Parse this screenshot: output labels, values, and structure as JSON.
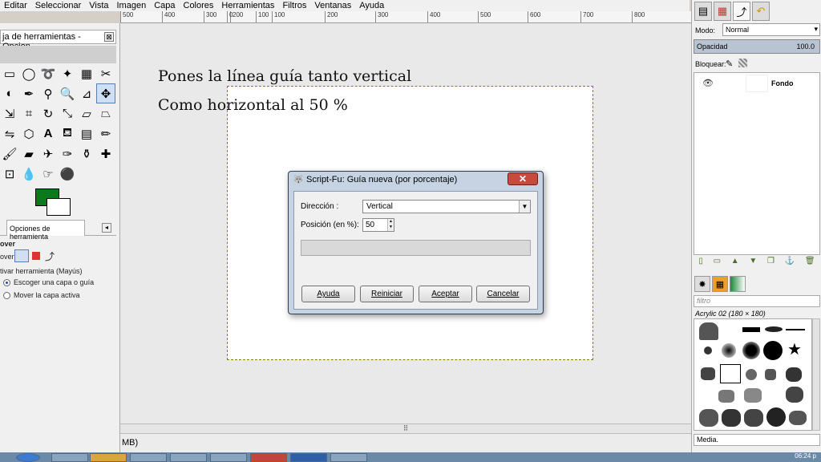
{
  "menubar": {
    "items": [
      "Editar",
      "Seleccionar",
      "Vista",
      "Imagen",
      "Capa",
      "Colores",
      "Herramientas",
      "Filtros",
      "Ventanas",
      "Ayuda"
    ]
  },
  "ruler": {
    "ticks": [
      "500",
      "400",
      "300",
      "200",
      "100",
      "0",
      "100",
      "200",
      "300",
      "400",
      "500",
      "600",
      "700",
      "800"
    ]
  },
  "canvas": {
    "line1": "Pones la línea guía tanto vertical",
    "line2": "Como horizontal al 50 %",
    "scroll_mark": "⠿",
    "status": "MB)"
  },
  "toolbox": {
    "title": "ja de herramientas - Opcion...",
    "close": "⊠",
    "options_tab": "Opciones de herramienta",
    "tab_menu": "◂",
    "tool_name": "over",
    "mode_label": "over:",
    "toggle_label": "tivar herramienta  (Mayús)",
    "radio1": "Escoger una capa o guía",
    "radio2": "Mover la capa activa",
    "fg_color": "#0b7a1d",
    "bg_color": "#ffffff"
  },
  "layers": {
    "mode_label": "Modo:",
    "mode_value": "Normal",
    "opacity_label": "Opacidad",
    "opacity_value": "100.0",
    "lock_label": "Bloquear:",
    "layer_name": "Fondo"
  },
  "brushes": {
    "filter_placeholder": "filtro",
    "selected_name": "Acrylic 02 (180 × 180)",
    "view_label": "Media."
  },
  "dialog": {
    "title": "Script-Fu: Guía nueva (por porcentaje)",
    "close": "✕",
    "direction_label": "Dirección :",
    "direction_value": "Vertical",
    "position_label": "Posición (en %):",
    "position_value": "50",
    "btn_help": "Ayuda",
    "btn_reset": "Reiniciar",
    "btn_accept": "Aceptar",
    "btn_cancel": "Cancelar"
  },
  "taskbar": {
    "clock": "06:24 p"
  }
}
